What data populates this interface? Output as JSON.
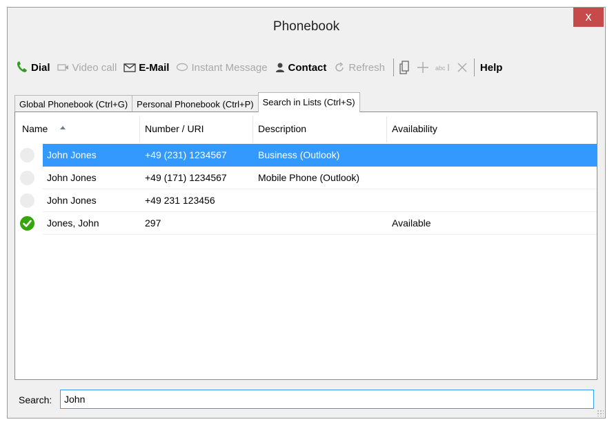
{
  "window": {
    "title": "Phonebook",
    "close_label": "x"
  },
  "toolbar": {
    "dial": "Dial",
    "video_call": "Video call",
    "email": "E-Mail",
    "instant_message": "Instant Message",
    "contact": "Contact",
    "refresh": "Refresh",
    "abc": "abc",
    "help": "Help"
  },
  "tabs": [
    {
      "label": "Global Phonebook  (Ctrl+G)"
    },
    {
      "label": "Personal Phonebook  (Ctrl+P)"
    },
    {
      "label": "Search in Lists (Ctrl+S)"
    }
  ],
  "columns": {
    "name": "Name",
    "number": "Number / URI",
    "description": "Description",
    "availability": "Availability"
  },
  "rows": [
    {
      "name": "John Jones",
      "number": "+49 (231) 1234567",
      "description": "Business (Outlook)",
      "availability": "",
      "status": "none",
      "selected": true
    },
    {
      "name": "John Jones",
      "number": "+49 (171) 1234567",
      "description": "Mobile Phone (Outlook)",
      "availability": "",
      "status": "none",
      "selected": false
    },
    {
      "name": "John Jones",
      "number": "+49 231 123456",
      "description": "",
      "availability": "",
      "status": "none",
      "selected": false
    },
    {
      "name": "Jones, John",
      "number": "297",
      "description": "",
      "availability": "Available",
      "status": "available",
      "selected": false
    }
  ],
  "search": {
    "label": "Search:",
    "value": "John"
  },
  "colors": {
    "selection": "#3399ff",
    "close": "#c74a4a",
    "available": "#34a50a",
    "dial_icon": "#2e9c1d"
  }
}
